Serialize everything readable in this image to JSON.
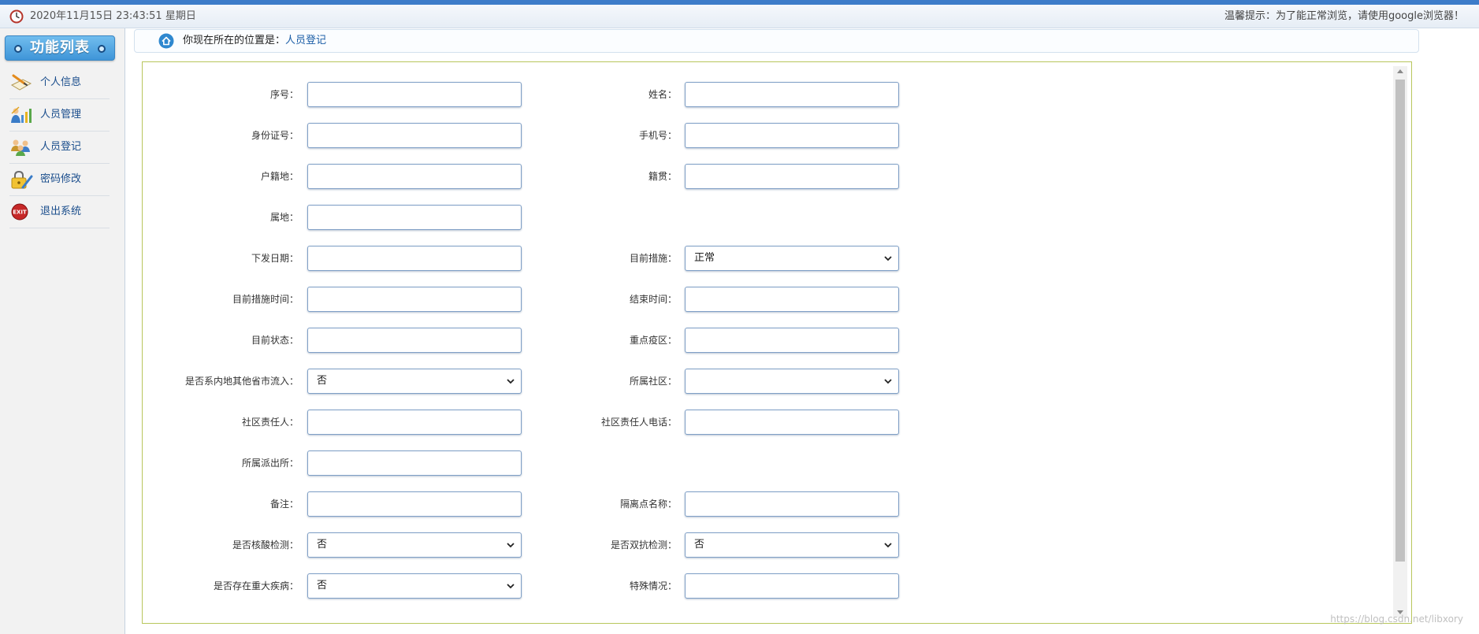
{
  "header": {
    "datetime": "2020年11月15日 23:43:51 星期日",
    "tip": "温馨提示：为了能正常浏览，请使用google浏览器！"
  },
  "sidebar": {
    "title": "功能列表",
    "items": [
      {
        "label": "个人信息",
        "icon": "profile-edit-icon"
      },
      {
        "label": "人员管理",
        "icon": "people-chart-icon"
      },
      {
        "label": "人员登记",
        "icon": "people-group-icon"
      },
      {
        "label": "密码修改",
        "icon": "lock-edit-icon"
      },
      {
        "label": "退出系统",
        "icon": "exit-icon",
        "icon_text": "EXIT"
      }
    ]
  },
  "breadcrumb": {
    "prefix": "你现在所在的位置是：",
    "current": "人员登记"
  },
  "form": {
    "rows": [
      {
        "left": {
          "label": "序号：",
          "type": "text",
          "value": ""
        },
        "right": {
          "label": "姓名：",
          "type": "text",
          "value": ""
        }
      },
      {
        "left": {
          "label": "身份证号：",
          "type": "text",
          "value": ""
        },
        "right": {
          "label": "手机号：",
          "type": "text",
          "value": ""
        }
      },
      {
        "left": {
          "label": "户籍地：",
          "type": "text",
          "value": ""
        },
        "right": {
          "label": "籍贯：",
          "type": "text",
          "value": ""
        }
      },
      {
        "left": {
          "label": "属地：",
          "type": "text",
          "value": ""
        }
      },
      {
        "left": {
          "label": "下发日期：",
          "type": "text",
          "value": ""
        },
        "right": {
          "label": "目前措施：",
          "type": "select",
          "value": "正常"
        }
      },
      {
        "left": {
          "label": "目前措施时间：",
          "type": "text",
          "value": ""
        },
        "right": {
          "label": "结束时间：",
          "type": "text",
          "value": ""
        }
      },
      {
        "left": {
          "label": "目前状态：",
          "type": "text",
          "value": ""
        },
        "right": {
          "label": "重点疫区：",
          "type": "text",
          "value": ""
        }
      },
      {
        "left": {
          "label": "是否系内地其他省市流入：",
          "type": "select",
          "value": "否"
        },
        "right": {
          "label": "所属社区：",
          "type": "select",
          "value": ""
        }
      },
      {
        "left": {
          "label": "社区责任人：",
          "type": "text",
          "value": ""
        },
        "right": {
          "label": "社区责任人电话：",
          "type": "text",
          "value": ""
        }
      },
      {
        "left": {
          "label": "所属派出所：",
          "type": "text",
          "value": ""
        }
      },
      {
        "left": {
          "label": "备注：",
          "type": "text",
          "value": ""
        },
        "right": {
          "label": "隔离点名称：",
          "type": "text",
          "value": ""
        }
      },
      {
        "left": {
          "label": "是否核酸检测：",
          "type": "select",
          "value": "否"
        },
        "right": {
          "label": "是否双抗检测：",
          "type": "select",
          "value": "否"
        }
      },
      {
        "left": {
          "label": "是否存在重大疾病：",
          "type": "select",
          "value": "否"
        },
        "right": {
          "label": "特殊情况：",
          "type": "text",
          "value": ""
        }
      }
    ]
  },
  "watermark": "https://blog.csdn.net/libxory",
  "colors": {
    "top_stripe": "#3d7cc9",
    "menu_title": "#4a9ddb",
    "menu_text": "#1a4d8c",
    "link": "#1d5fa7",
    "frame_border": "#b8c65c",
    "input_border": "#7f9fc6"
  }
}
